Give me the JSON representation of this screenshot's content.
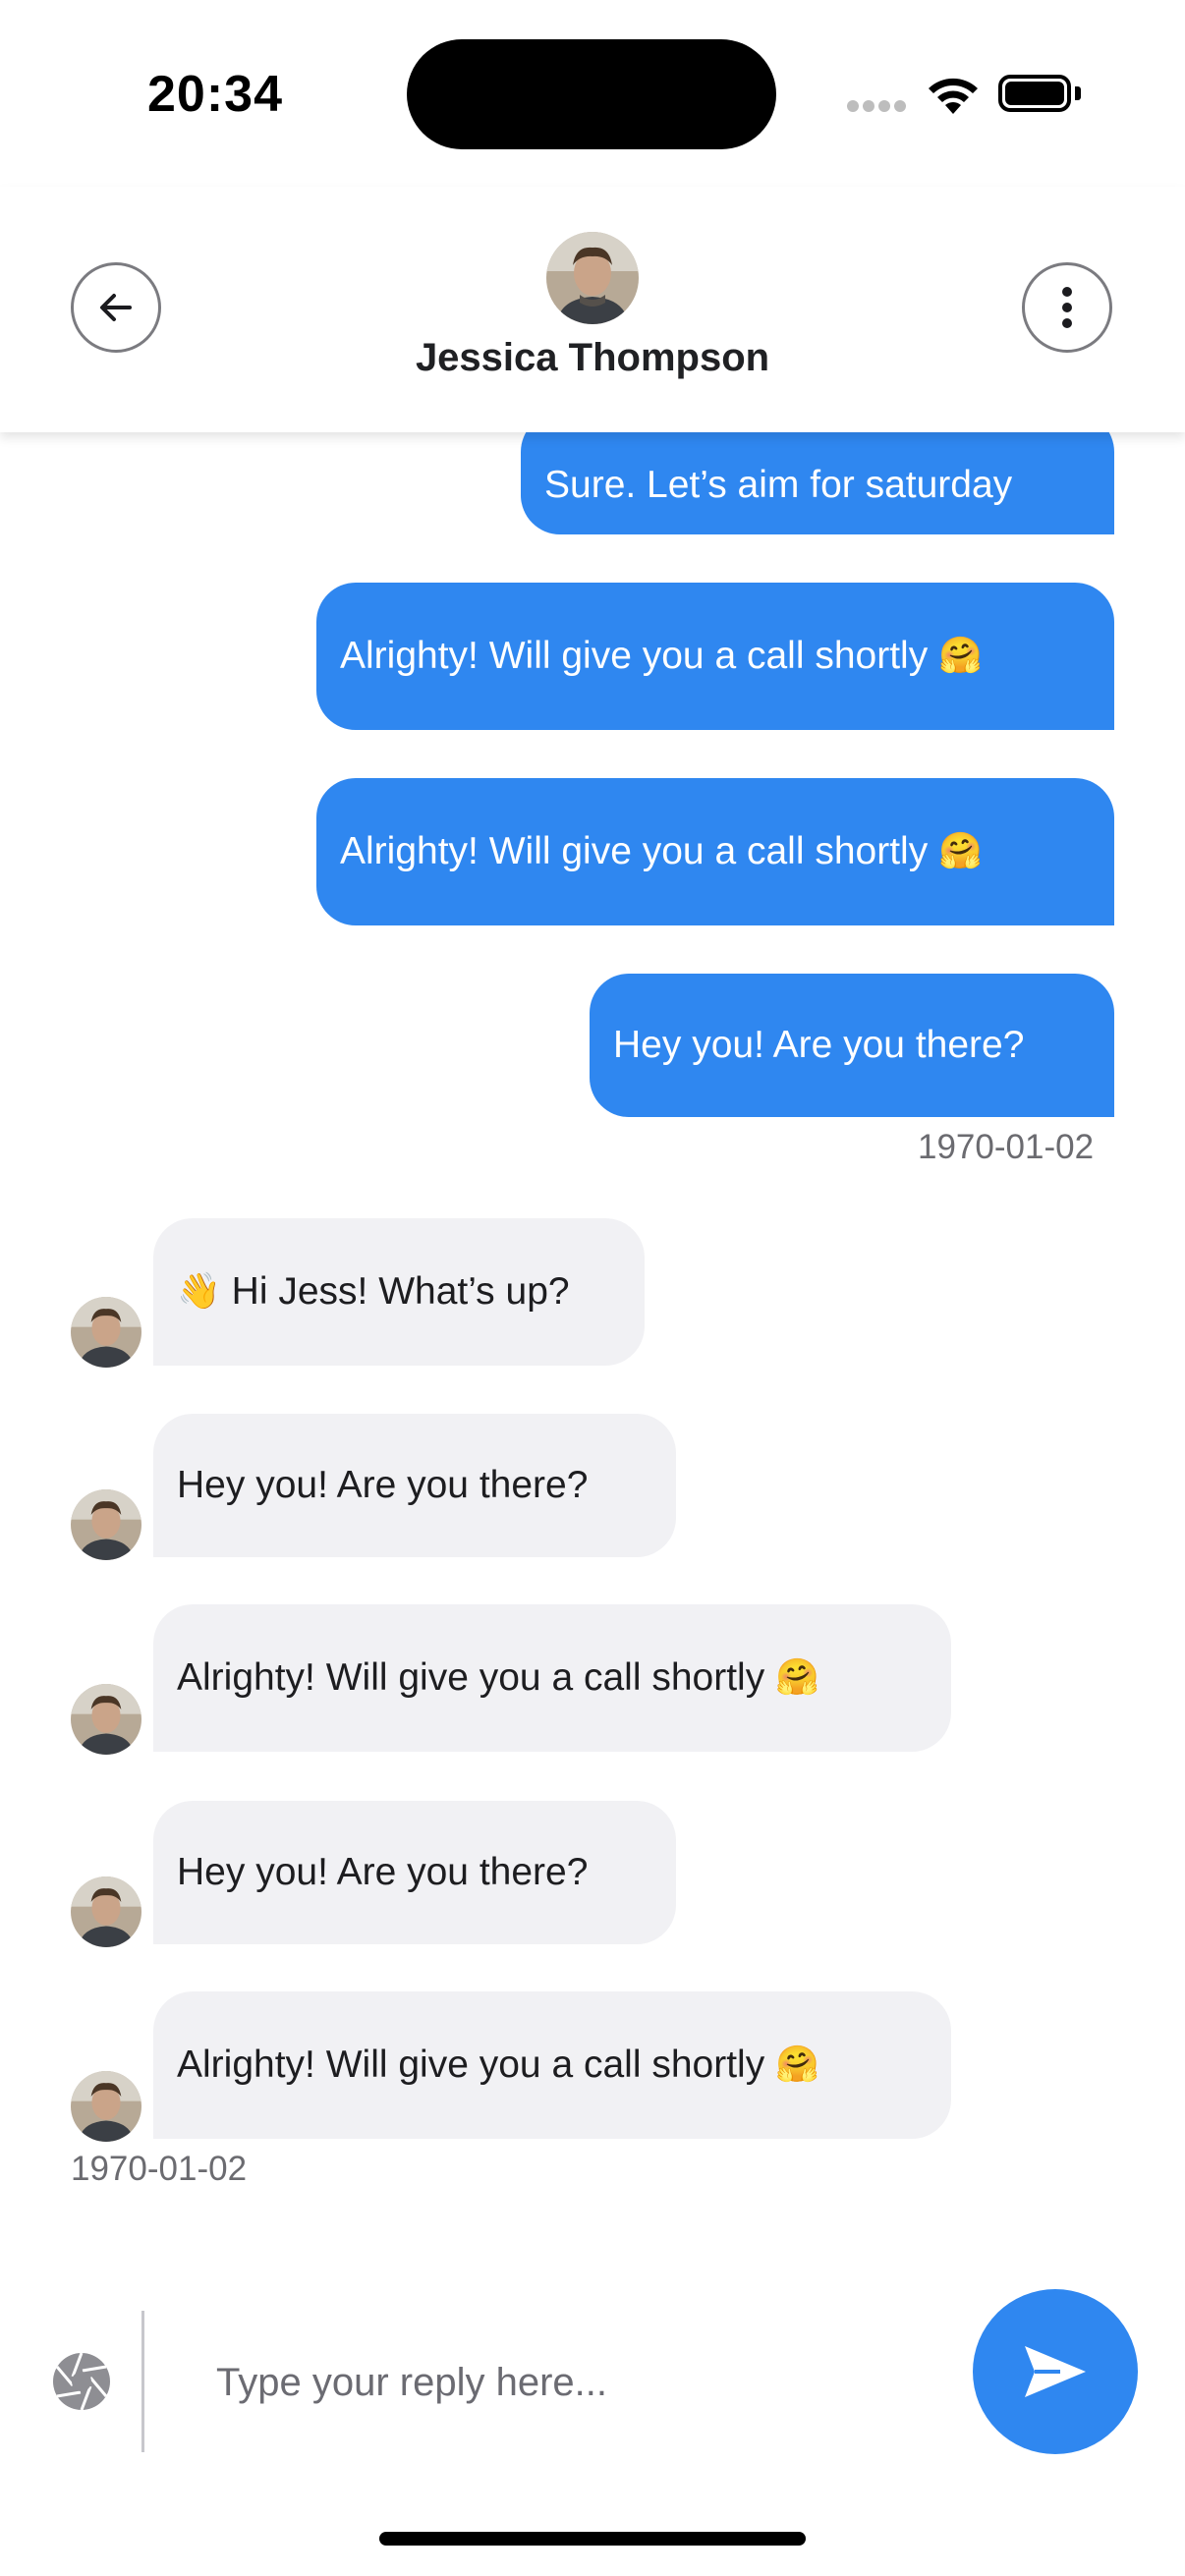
{
  "status_bar": {
    "time": "20:34"
  },
  "header": {
    "contact_name": "Jessica Thompson",
    "back_icon": "arrow-left-icon",
    "more_icon": "more-vertical-icon"
  },
  "messages": [
    {
      "direction": "out",
      "text": "Sure. Let’s aim for saturday"
    },
    {
      "direction": "out",
      "text": "Alrighty! Will give you a call shortly",
      "emoji": "🤗"
    },
    {
      "direction": "out",
      "text": "Alrighty! Will give you a call shortly",
      "emoji": "🤗"
    },
    {
      "direction": "out",
      "text": "Hey you! Are you there?"
    },
    {
      "direction": "in",
      "emoji_prefix": "👋",
      "text": "Hi Jess! What’s up?"
    },
    {
      "direction": "in",
      "text": "Hey you! Are you there?"
    },
    {
      "direction": "in",
      "text": "Alrighty! Will give you a call shortly",
      "emoji": "🤗"
    },
    {
      "direction": "in",
      "text": "Hey you! Are you there?"
    },
    {
      "direction": "in",
      "text": "Alrighty! Will give you a call shortly",
      "emoji": "🤗"
    }
  ],
  "dates": {
    "outgoing_group": "1970-01-02",
    "incoming_group": "1970-01-02"
  },
  "composer": {
    "placeholder": "Type your reply here...",
    "camera_icon": "camera-aperture-icon",
    "send_icon": "send-icon"
  },
  "colors": {
    "accent": "#2f87f0",
    "incoming_bubble": "#f1f1f4"
  }
}
